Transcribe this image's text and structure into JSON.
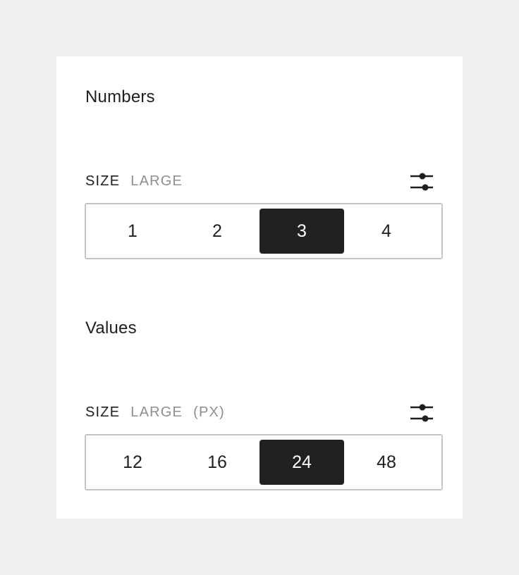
{
  "colors": {
    "background": "#efefef",
    "card": "#ffffff",
    "text": "#1f1f1f",
    "muted": "#8f8f8f",
    "selected_bg": "#212121",
    "border": "#c4c4c4"
  },
  "numbers": {
    "title": "Numbers",
    "size_label": "SIZE",
    "size_value": "LARGE",
    "settings_icon": "sliders-icon",
    "options": [
      "1",
      "2",
      "3",
      "4"
    ],
    "selected": "3"
  },
  "values": {
    "title": "Values",
    "size_label": "SIZE",
    "size_value": "LARGE",
    "size_unit": "(PX)",
    "settings_icon": "sliders-icon",
    "options": [
      "12",
      "16",
      "24",
      "48"
    ],
    "selected": "24"
  }
}
